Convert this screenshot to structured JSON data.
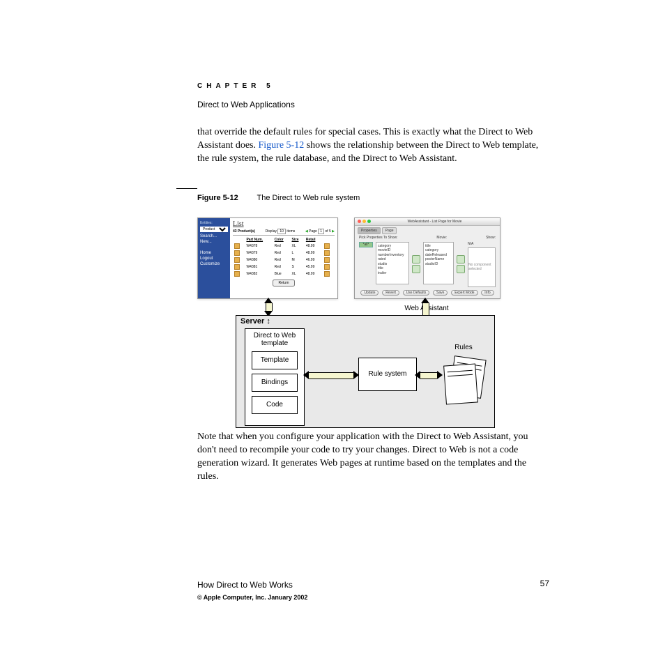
{
  "chapter": {
    "label": "CHAPTER 5",
    "title": "Direct to Web Applications"
  },
  "paragraph1_a": "that override the default rules for special cases. This is exactly what the Direct to Web Assistant does. ",
  "paragraph1_link": "Figure 5-12",
  "paragraph1_b": " shows the relationship between the Direct to Web template, the rule system, the rule database, and the Direct to Web Assistant.",
  "figure": {
    "label": "Figure 5-12",
    "caption": "The Direct to Web rule system",
    "web_assistant_label": "Web Assistant",
    "browser": {
      "entities_label": "Entities:",
      "entity_selected": "Product",
      "side_items": [
        "Search...",
        "New...",
        "Home",
        "Logout",
        "Customize"
      ],
      "list_title": "List",
      "count_label": "43 Product(s)",
      "display_label": "Display",
      "display_value": "10",
      "items_label": "items",
      "page_label": "Page",
      "page_value": "1",
      "page_of": "of 5",
      "columns": [
        "Part Num.",
        "Color",
        "Size",
        "Retail"
      ],
      "rows": [
        [
          "W4378",
          "Red",
          "XL",
          "48.99"
        ],
        [
          "W4379",
          "Red",
          "L",
          "48.99"
        ],
        [
          "W4380",
          "Red",
          "M",
          "46.99"
        ],
        [
          "W4381",
          "Red",
          "S",
          "45.99"
        ],
        [
          "W4382",
          "Blue",
          "XL",
          "48.99"
        ]
      ],
      "return_label": "Return"
    },
    "assistant": {
      "window_title": "WebAssistant - List Page for Movie",
      "tab_properties": "Properties",
      "tab_page": "Page",
      "pick_label": "Pick Properties To Show:",
      "entity_label": "Movie:",
      "show_label": "Show:",
      "all_label": "*all*",
      "left_items": [
        "category",
        "movieID",
        "numberInventory",
        "rated",
        "studio",
        "title",
        "trailer"
      ],
      "mid_items": [
        "title",
        "category",
        "dateReleased",
        "posterName",
        "studioID"
      ],
      "right_msg": "No component selected",
      "type_label": "N/A",
      "buttons": [
        "Update",
        "Revert",
        "Use Defaults",
        "Save",
        "Expert Mode",
        "Info"
      ]
    },
    "server": {
      "label": "Server",
      "d2w_title_a": "Direct to Web",
      "d2w_title_b": "template",
      "template": "Template",
      "bindings": "Bindings",
      "code": "Code",
      "rule_system": "Rule system",
      "rules": "Rules"
    }
  },
  "paragraph2": "Note that when you configure your application with the Direct to Web Assistant, you don't need to recompile your code to try your changes. Direct to Web is not a code generation wizard. It generates Web pages at runtime based on the templates and the rules.",
  "footer": {
    "section": "How Direct to Web Works",
    "page": "57",
    "copyright": "© Apple Computer, Inc. January 2002"
  }
}
